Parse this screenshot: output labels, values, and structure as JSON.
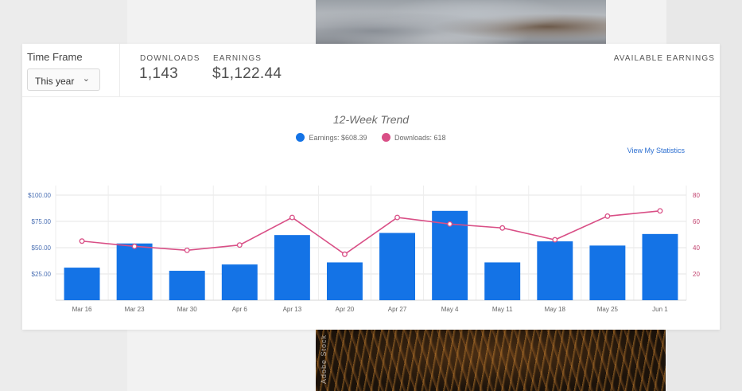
{
  "colors": {
    "earnings": "#1473e6",
    "downloads": "#d94f86",
    "axis_left": "#4a6fb3",
    "axis_right": "#c2436f",
    "grid": "#e4e4e4",
    "link": "#2c6fd1"
  },
  "filters": {
    "time_frame_label": "Time Frame",
    "time_frame_value": "This year"
  },
  "stats": {
    "downloads_label": "DOWNLOADS",
    "downloads_value": "1,143",
    "earnings_label": "EARNINGS",
    "earnings_value": "$1,122.44",
    "available_label": "AVAILABLE EARNINGS"
  },
  "legend": {
    "earnings": "Earnings: $608.39",
    "downloads": "Downloads: 618"
  },
  "links": {
    "view_stats": "View My Statistics"
  },
  "background": {
    "photo_label": "Adobe Stock"
  },
  "chart_data": {
    "type": "bar",
    "title": "12-Week Trend",
    "categories": [
      "Mar 16",
      "Mar 23",
      "Mar 30",
      "Apr 6",
      "Apr 13",
      "Apr 20",
      "Apr 27",
      "May 4",
      "May 11",
      "May 18",
      "May 25",
      "Jun 1"
    ],
    "series": [
      {
        "name": "Earnings",
        "type": "bar",
        "axis": "left",
        "values": [
          31,
          54,
          28,
          34,
          62,
          36,
          64,
          85,
          36,
          56,
          52,
          63
        ]
      },
      {
        "name": "Downloads",
        "type": "line",
        "axis": "right",
        "values": [
          45,
          41,
          38,
          42,
          63,
          35,
          63,
          58,
          55,
          46,
          64,
          68
        ]
      }
    ],
    "y_left": {
      "ticks": [
        "$25.00",
        "$50.00",
        "$75.00",
        "$100.00"
      ],
      "tick_values": [
        25,
        50,
        75,
        100
      ],
      "range": [
        0,
        100
      ]
    },
    "y_right": {
      "ticks": [
        "20",
        "40",
        "60",
        "80"
      ],
      "tick_values": [
        20,
        40,
        60,
        80
      ],
      "range": [
        0,
        80
      ]
    },
    "grid": true
  }
}
